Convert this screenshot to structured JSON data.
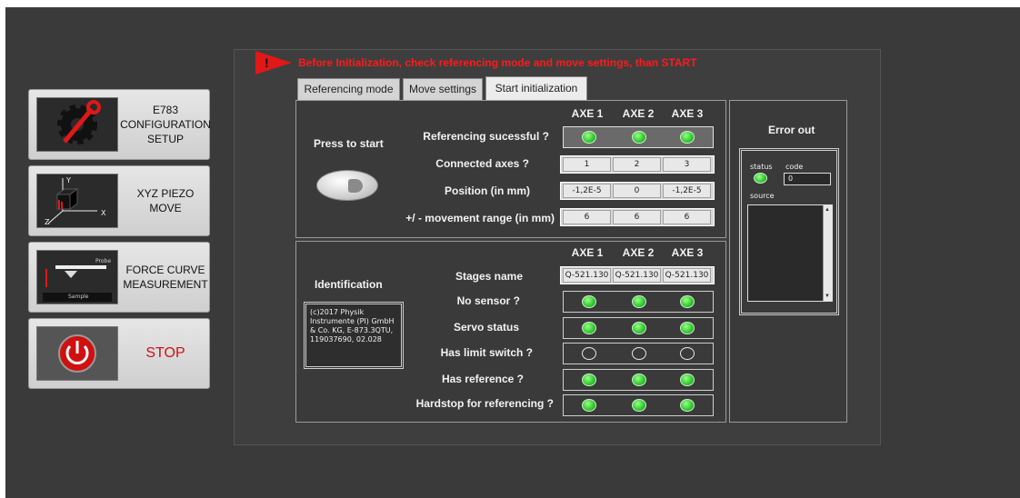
{
  "sidebar": {
    "config_label": "E783\nCONFIGURATION\nSETUP",
    "xyz_label": "XYZ PIEZO\nMOVE",
    "force_label": "FORCE CURVE\nMEASUREMENT",
    "force_probe": "Probe",
    "force_sample": "Sample",
    "stop_label": "STOP",
    "xyz_axes": {
      "y": "Y",
      "x": "X",
      "z": "Z"
    }
  },
  "warning": "Before  Initialization, check referencing mode and move settings, than START",
  "tabs": [
    {
      "label": "Referencing mode",
      "active": false
    },
    {
      "label": "Move settings",
      "active": false
    },
    {
      "label": "Start initialization",
      "active": true
    }
  ],
  "init": {
    "press_label": "Press to start",
    "axes": [
      "AXE 1",
      "AXE 2",
      "AXE 3"
    ],
    "rows": {
      "ref_success": "Referencing sucessful ?",
      "connected": "Connected axes ?",
      "position": "Position (in mm)",
      "range": "+/ - movement range (in mm)"
    },
    "connected_values": [
      "1",
      "2",
      "3"
    ],
    "position_values": [
      "-1,2E-5",
      "0",
      "-1,2E-5"
    ],
    "range_values": [
      "6",
      "6",
      "6"
    ]
  },
  "ident": {
    "label": "Identification",
    "text": "(c)2017 Physik Instrumente (PI) GmbH & Co. KG, E-873.3QTU, 119037690, 02.028",
    "axes": [
      "AXE 1",
      "AXE 2",
      "AXE 3"
    ],
    "rows": {
      "stages": "Stages name",
      "no_sensor": "No sensor ?",
      "servo": "Servo status",
      "limit": "Has limit switch ?",
      "reference": "Has reference ?",
      "hardstop": "Hardstop for referencing ?"
    },
    "stage_names": [
      "Q-521.130",
      "Q-521.130",
      "Q-521.130"
    ]
  },
  "error_out": {
    "title": "Error out",
    "status_label": "status",
    "code_label": "code",
    "code_value": "0",
    "source_label": "source"
  },
  "colors": {
    "led_on": "#2ec62e",
    "warning": "#ff1a1a",
    "stop": "#d01010"
  }
}
